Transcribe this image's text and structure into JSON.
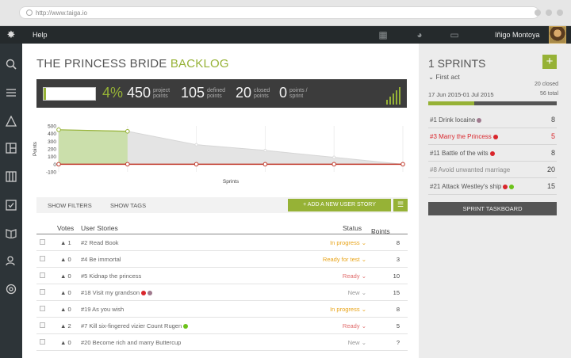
{
  "browser": {
    "url": "http://www.taiga.io"
  },
  "topbar": {
    "help": "Help",
    "user_name": "Iñigo Montoya"
  },
  "page": {
    "title_main": "THE PRINCESS BRIDE",
    "title_accent": "BACKLOG"
  },
  "stats": {
    "progress_percent": 4,
    "percent_label": "4%",
    "project_points": "450",
    "project_points_label": "project points",
    "defined_points": "105",
    "defined_points_label": "defined points",
    "closed_points": "20",
    "closed_points_label": "closed points",
    "points_sprint": "0",
    "points_sprint_label": "points / sprint"
  },
  "chart_data": {
    "type": "area",
    "xlabel": "Sprints",
    "ylabel": "Points",
    "yticks": [
      "500",
      "400",
      "300",
      "200",
      "100",
      "0",
      "-100"
    ],
    "ylim": [
      -100,
      500
    ],
    "x": [
      0,
      1,
      2,
      3,
      4,
      5
    ],
    "series": [
      {
        "name": "",
        "color": "#96b236",
        "values": [
          450,
          430,
          null,
          null,
          null,
          null
        ]
      },
      {
        "name": "",
        "color": "#cfcfcf",
        "values": [
          450,
          430,
          255,
          180,
          90,
          0
        ]
      },
      {
        "name": "",
        "color": "#c0392b",
        "values": [
          0,
          0,
          0,
          0,
          0,
          0
        ]
      }
    ],
    "grid": true
  },
  "filters": {
    "show_filters": "SHOW FILTERS",
    "show_tags": "SHOW TAGS",
    "add_story": "+ ADD A NEW USER STORY"
  },
  "table": {
    "headers": {
      "votes": "Votes",
      "stories": "User Stories",
      "status": "Status",
      "points": "Points"
    },
    "rows": [
      {
        "votes": "1",
        "story": "#2 Read Book",
        "status": "In progress",
        "status_color": "#e8a317",
        "points": "8",
        "dots": []
      },
      {
        "votes": "0",
        "story": "#4 Be immortal",
        "status": "Ready for test",
        "status_color": "#e8a317",
        "points": "3",
        "dots": []
      },
      {
        "votes": "0",
        "story": "#5 Kidnap the princess",
        "status": "Ready",
        "status_color": "#e06b6b",
        "points": "10",
        "dots": []
      },
      {
        "votes": "0",
        "story": "#18 Visit my grandson",
        "status": "New",
        "status_color": "#999999",
        "points": "15",
        "dots": [
          "#d9262c",
          "#a07a8e"
        ]
      },
      {
        "votes": "0",
        "story": "#19 As you wish",
        "status": "In progress",
        "status_color": "#e8a317",
        "points": "8",
        "dots": []
      },
      {
        "votes": "2",
        "story": "#7 Kill six-fingered vizier Count Rugen",
        "status": "Ready",
        "status_color": "#e06b6b",
        "points": "5",
        "dots": [
          "#6cc21a"
        ]
      },
      {
        "votes": "0",
        "story": "#20 Become rich and marry Buttercup",
        "status": "New",
        "status_color": "#999999",
        "points": "?",
        "dots": []
      }
    ]
  },
  "sprints": {
    "title": "1 SPRINTS",
    "name": "First act",
    "dates": "17 Jun 2015-01 Jul 2015",
    "closed": "20 closed",
    "total": "56 total",
    "progress_fraction": 0.36,
    "items": [
      {
        "label": "#1 Drink locaine",
        "points": "8",
        "color": "#555555",
        "dots": [
          "#a07a8e"
        ]
      },
      {
        "label": "#3 Marry the Princess",
        "points": "5",
        "color": "#d9262c",
        "dots": [
          "#d9262c"
        ]
      },
      {
        "label": "#11 Battle of the wits",
        "points": "8",
        "color": "#555555",
        "dots": [
          "#d9262c"
        ]
      },
      {
        "label": "#8 Avoid unwanted marriage",
        "points": "20",
        "color": "#888888",
        "dots": []
      },
      {
        "label": "#21 Attack Westley's ship",
        "points": "15",
        "color": "#555555",
        "dots": [
          "#d9262c",
          "#6cc21a"
        ]
      }
    ],
    "taskboard": "SPRINT TASKBOARD"
  },
  "colors": {
    "accent": "#96b236",
    "dark": "#3c3c3c",
    "sidebar": "#2d3438"
  }
}
